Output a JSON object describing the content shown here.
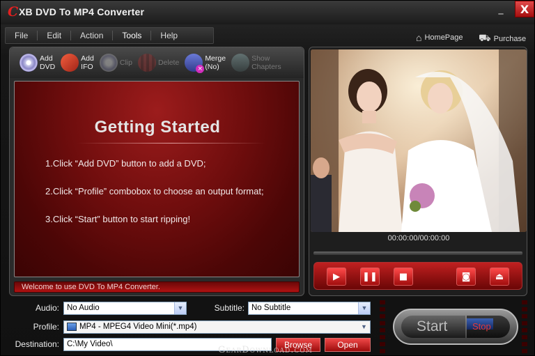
{
  "window": {
    "logo_letter": "C",
    "title": "XB DVD To MP4 Converter",
    "minimize_label": "_",
    "close_label": "X"
  },
  "menu": {
    "items": [
      "File",
      "Edit",
      "Action",
      "Tools",
      "Help"
    ]
  },
  "links": {
    "homepage": "HomePage",
    "purchase": "Purchase"
  },
  "toolbar": {
    "add_dvd": [
      "Add",
      "DVD"
    ],
    "add_ifo": [
      "Add",
      "IFO"
    ],
    "clip": "Clip",
    "delete": "Delete",
    "merge": [
      "Merge",
      "(No)"
    ],
    "show_chapters": [
      "Show",
      "Chapters"
    ]
  },
  "getting_started": {
    "heading": "Getting  Started",
    "steps": [
      "1.Click “Add DVD” button to add a DVD;",
      "2.Click “Profile” combobox to choose an output format;",
      "3.Click “Start” button to start ripping!"
    ]
  },
  "status": {
    "message": "Welcome to use DVD To MP4 Converter."
  },
  "player": {
    "time": "00:00:00/00:00:00",
    "progress_fraction": 0
  },
  "form": {
    "audio_label": "Audio:",
    "audio_value": "No Audio",
    "subtitle_label": "Subtitle:",
    "subtitle_value": "No Subtitle",
    "profile_label": "Profile:",
    "profile_value": "MP4 - MPEG4 Video Mini(*.mp4)",
    "destination_label": "Destination:",
    "destination_value": "C:\\My Video\\",
    "browse_label": "Browse",
    "open_label": "Open"
  },
  "actions": {
    "start_label": "Start",
    "stop_label": "Stop"
  },
  "watermark": "GearDownload.com",
  "colors": {
    "accent_red": "#b01212",
    "panel_dark": "#1e1e1e"
  }
}
